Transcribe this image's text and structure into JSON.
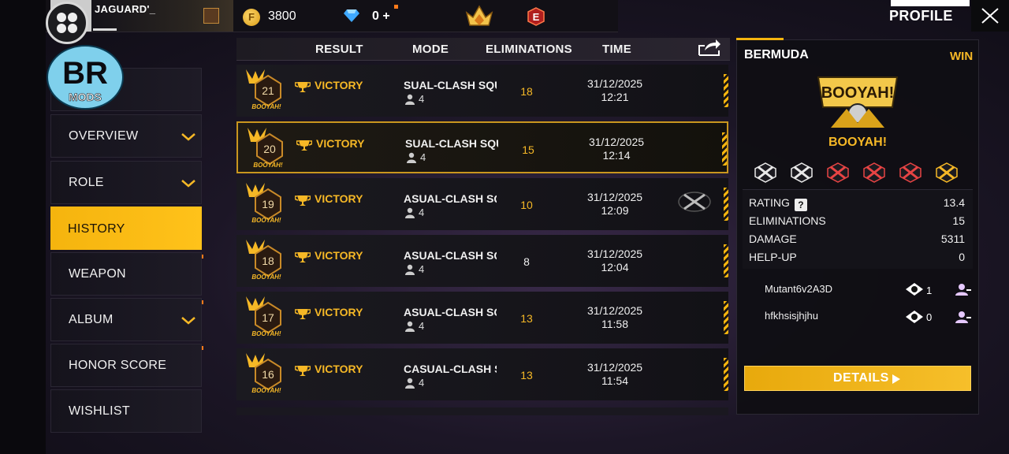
{
  "header": {
    "player_name": "JAGUARD'_",
    "coins": "3800",
    "diamonds": "0 +",
    "coin_symbol": "F",
    "rank_icon": "crown-rank-icon",
    "badge_letter": "E",
    "profile_title": "PROFILE"
  },
  "logo": {
    "line1": "BR",
    "line2": "MODS"
  },
  "sidebar": {
    "items": [
      {
        "label": "",
        "has_chevron": false
      },
      {
        "label": "OVERVIEW",
        "has_chevron": true
      },
      {
        "label": "ROLE",
        "has_chevron": true
      },
      {
        "label": "HISTORY",
        "has_chevron": false,
        "active": true
      },
      {
        "label": "WEAPON",
        "has_chevron": false
      },
      {
        "label": "ALBUM",
        "has_chevron": true
      },
      {
        "label": "HONOR SCORE",
        "has_chevron": false
      },
      {
        "label": "WISHLIST",
        "has_chevron": false
      }
    ]
  },
  "table": {
    "headers": {
      "result": "RESULT",
      "mode": "MODE",
      "eliminations": "ELIMINATIONS",
      "time": "TIME"
    },
    "rows": [
      {
        "rank": "21",
        "booyah": "BOOYAH!",
        "result": "VICTORY",
        "mode": "SUAL-CLASH SQU",
        "players": "4",
        "eliminations": "18",
        "date": "31/12/2025",
        "time": "12:21",
        "elim_gold": true
      },
      {
        "rank": "20",
        "booyah": "BOOYAH!",
        "result": "VICTORY",
        "mode": "SUAL-CLASH SQU",
        "players": "4",
        "eliminations": "15",
        "date": "31/12/2025",
        "time": "12:14",
        "elim_gold": true,
        "selected": true
      },
      {
        "rank": "19",
        "booyah": "BOOYAH!",
        "result": "VICTORY",
        "mode": "ASUAL-CLASH SQ",
        "players": "4",
        "eliminations": "10",
        "date": "31/12/2025",
        "time": "12:09",
        "elim_gold": true,
        "cross_icon": true
      },
      {
        "rank": "18",
        "booyah": "BOOYAH!",
        "result": "VICTORY",
        "mode": "ASUAL-CLASH SQ",
        "players": "4",
        "eliminations": "8",
        "date": "31/12/2025",
        "time": "12:04",
        "elim_gold": false
      },
      {
        "rank": "17",
        "booyah": "BOOYAH!",
        "result": "VICTORY",
        "mode": "ASUAL-CLASH SC",
        "players": "4",
        "eliminations": "13",
        "date": "31/12/2025",
        "time": "11:58",
        "elim_gold": true
      },
      {
        "rank": "16",
        "booyah": "BOOYAH!",
        "result": "VICTORY",
        "mode": "CASUAL-CLASH SI",
        "players": "4",
        "eliminations": "13",
        "date": "31/12/2025",
        "time": "11:54",
        "elim_gold": true
      }
    ]
  },
  "detail": {
    "map": "BERMUDA",
    "outcome": "WIN",
    "banner_text": "BOOYAH!",
    "booyah_label": "BOOYAH!",
    "honor_icons": [
      "honor-badge-1-icon",
      "honor-badge-2-icon",
      "honor-badge-3-icon",
      "honor-badge-4-icon",
      "honor-badge-5-icon",
      "honor-badge-6-icon"
    ],
    "stats": [
      {
        "label": "RATING",
        "value": "13.4",
        "help": "?"
      },
      {
        "label": "ELIMINATIONS",
        "value": "15"
      },
      {
        "label": "DAMAGE",
        "value": "5311"
      },
      {
        "label": "HELP-UP",
        "value": "0"
      }
    ],
    "team": [
      {
        "name": "Mutant6v2A3D",
        "count": "1"
      },
      {
        "name": "hfkhsisjhjhu",
        "count": "0"
      }
    ],
    "details_button": "DETAILS"
  },
  "colors": {
    "accent": "#f5b40e",
    "gold_text": "#f6b826",
    "panel": "#16141b"
  }
}
